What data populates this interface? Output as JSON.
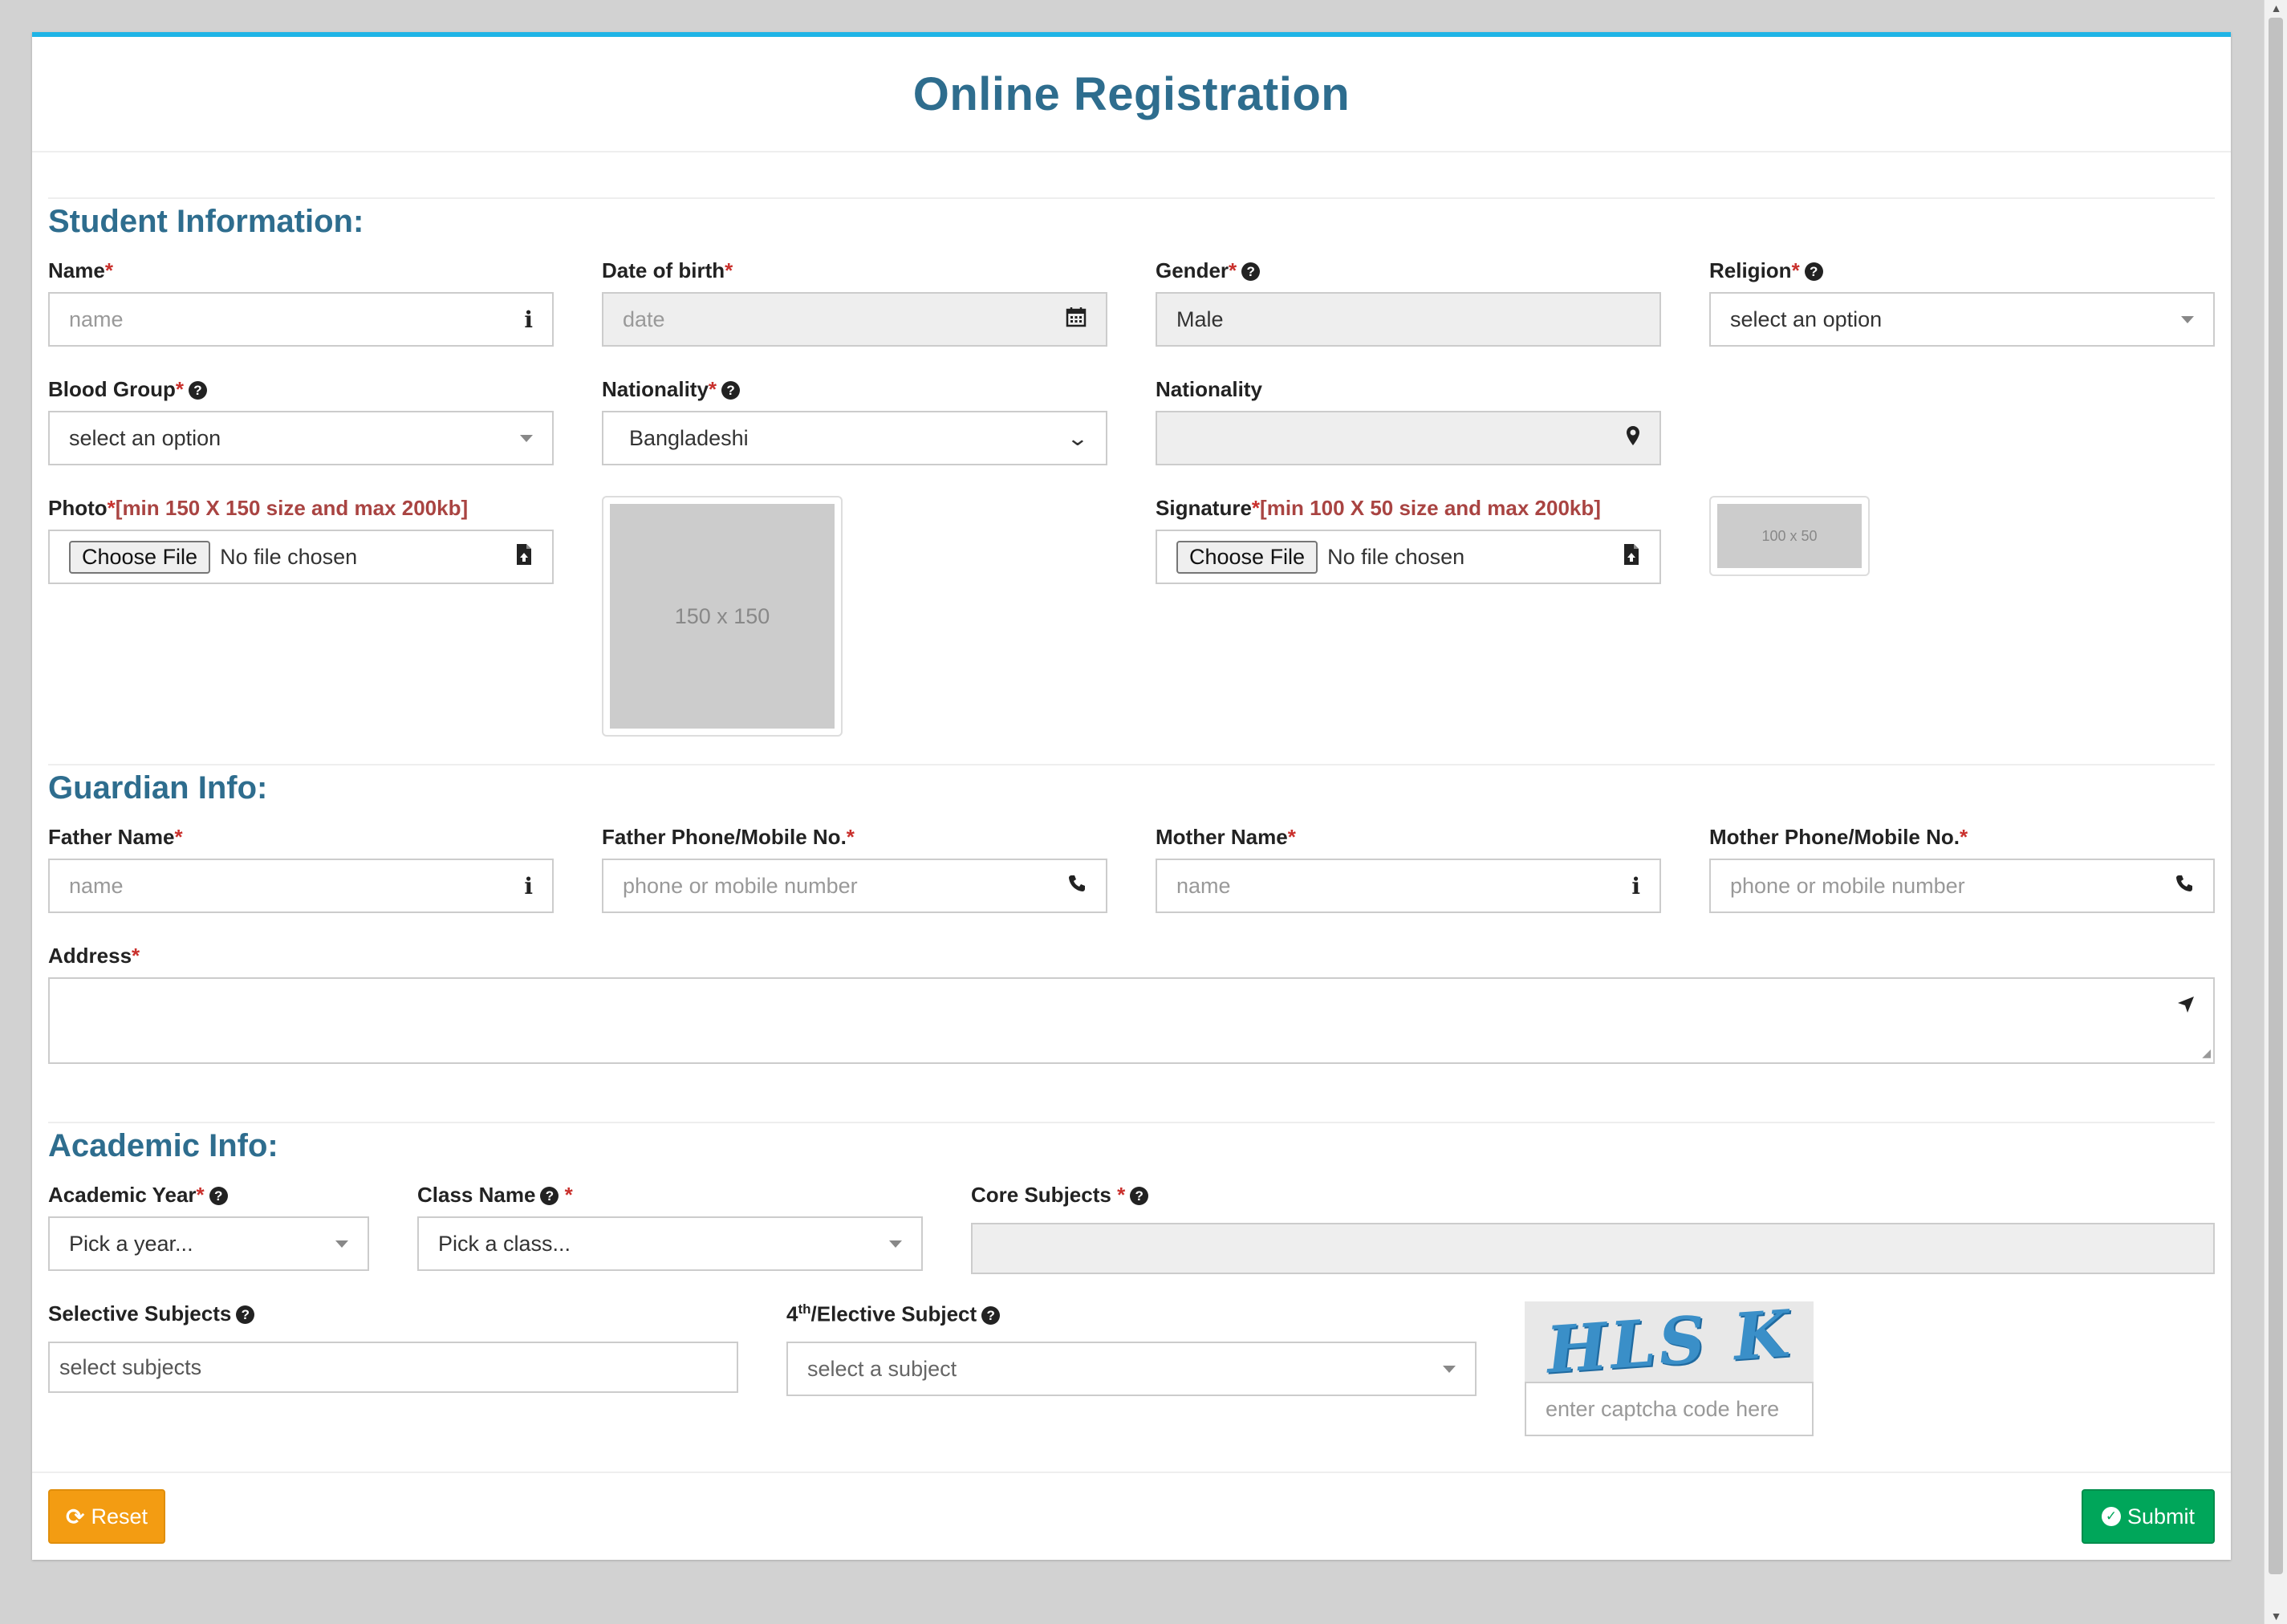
{
  "title": "Online Registration",
  "student": {
    "heading": "Student Information:",
    "name_label": "Name",
    "name_placeholder": "name",
    "dob_label": "Date of birth",
    "dob_placeholder": "date",
    "gender_label": "Gender",
    "gender_value": "Male",
    "religion_label": "Religion",
    "religion_value": "select an option",
    "blood_label": "Blood Group",
    "blood_value": "select an option",
    "nationality_label": "Nationality",
    "nationality_value": "Bangladeshi",
    "nationality2_label": "Nationality",
    "photo_label": "Photo",
    "photo_hint": "[min 150 X 150 size and max 200kb]",
    "choose_file": "Choose File",
    "no_file": "No file chosen",
    "photo_preview": "150 x 150",
    "signature_label": "Signature",
    "signature_hint": "[min 100 X 50 size and max 200kb]",
    "signature_preview": "100 x 50"
  },
  "guardian": {
    "heading": "Guardian Info:",
    "father_name_label": "Father Name",
    "father_name_placeholder": "name",
    "father_phone_label": "Father Phone/Mobile No.",
    "father_phone_placeholder": "phone or mobile number",
    "mother_name_label": "Mother Name",
    "mother_name_placeholder": "name",
    "mother_phone_label": "Mother Phone/Mobile No.",
    "mother_phone_placeholder": "phone or mobile number",
    "address_label": "Address"
  },
  "academic": {
    "heading": "Academic Info:",
    "year_label": "Academic Year",
    "year_value": "Pick a year...",
    "class_label": "Class Name",
    "class_value": "Pick a class...",
    "core_label": "Core Subjects",
    "selective_label": "Selective Subjects",
    "selective_placeholder": "select subjects",
    "elective_label_num": "4",
    "elective_label_sup": "th",
    "elective_label_rest": "/Elective Subject",
    "elective_value": "select a subject",
    "captcha_text": "HLS K",
    "captcha_placeholder": "enter captcha code here"
  },
  "actions": {
    "reset": "Reset",
    "submit": "Submit"
  },
  "icons": {
    "info": "info-icon",
    "calendar": "calendar-icon",
    "map_marker": "map-marker-icon",
    "file_upload": "file-upload-icon",
    "phone": "phone-icon",
    "location_arrow": "location-arrow-icon",
    "question": "question-circle-icon",
    "refresh": "refresh-icon",
    "check_circle": "check-circle-icon"
  },
  "colors": {
    "accent_top": "#1fb4e6",
    "heading": "#2e6d8e",
    "required": "#c9302c",
    "reset": "#f39c12",
    "submit": "#00a65a"
  }
}
